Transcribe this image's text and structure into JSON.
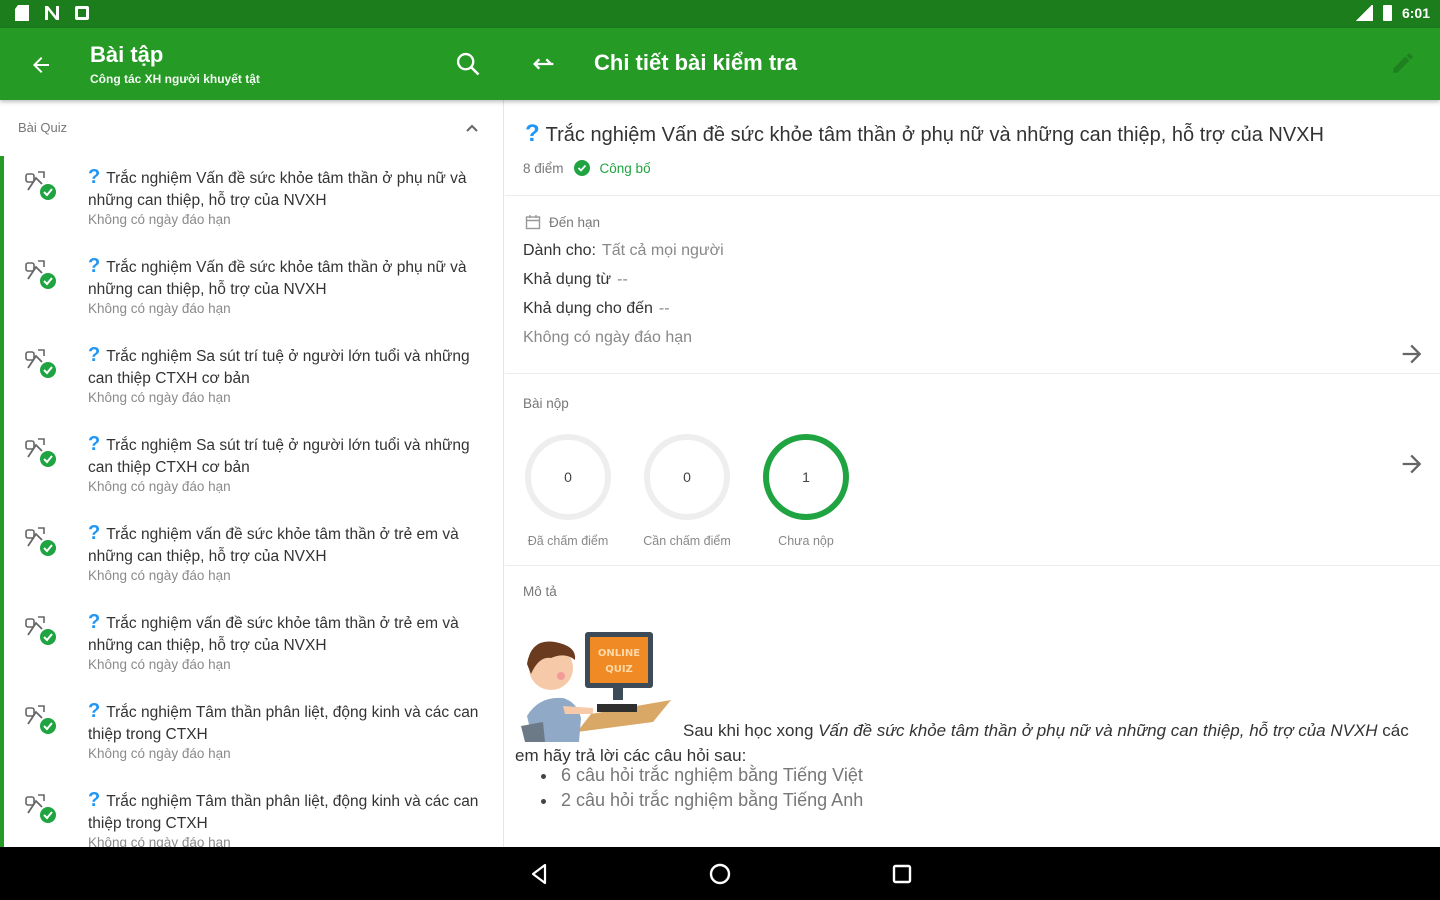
{
  "status_bar": {
    "time": "6:01",
    "left_icons": [
      "sd-card-icon",
      "n-icon",
      "photo-icon"
    ],
    "right_icons": [
      "signal-icon",
      "battery-icon"
    ]
  },
  "app_bar": {
    "title": "Bài tập",
    "subtitle": "Công tác XH người khuyết tật",
    "detail_title": "Chi tiết bài kiểm tra",
    "color": "#259a25"
  },
  "left_panel": {
    "section_label": "Bài Quiz",
    "items": [
      {
        "title": "Trắc nghiệm Vấn đề sức khỏe tâm thần ở phụ nữ và những can thiệp, hỗ trợ của NVXH",
        "due": "Không có ngày đáo hạn"
      },
      {
        "title": "Trắc nghiệm Vấn đề sức khỏe tâm thần ở phụ nữ và những can thiệp, hỗ trợ của NVXH",
        "due": "Không có ngày đáo hạn"
      },
      {
        "title": "Trắc nghiệm Sa sút trí tuệ ở người lớn tuổi và những can thiệp CTXH cơ bản",
        "due": "Không có ngày đáo hạn"
      },
      {
        "title": "Trắc nghiệm Sa sút trí tuệ ở người lớn tuổi và những can thiệp CTXH cơ bản",
        "due": "Không có ngày đáo hạn"
      },
      {
        "title": "Trắc nghiệm vấn đề sức khỏe tâm thần ở trẻ em và những can thiệp, hỗ trợ của NVXH",
        "due": "Không có ngày đáo hạn"
      },
      {
        "title": "Trắc nghiệm vấn đề sức khỏe tâm thần ở trẻ em và những can thiệp, hỗ trợ của NVXH",
        "due": "Không có ngày đáo hạn"
      },
      {
        "title": "Trắc nghiệm Tâm thần phân liệt, động kinh và các can thiệp trong CTXH",
        "due": "Không có ngày đáo hạn"
      },
      {
        "title": "Trắc nghiệm Tâm thần phân liệt, động kinh và các can thiệp trong CTXH",
        "due": "Không có ngày đáo hạn"
      }
    ]
  },
  "detail": {
    "question_mark": "?",
    "title": "Trắc nghiệm Vấn đề sức khỏe tâm thần ở phụ nữ và những can thiệp, hỗ trợ của NVXH",
    "points": "8 điểm",
    "published": "Công bố",
    "due": {
      "header": "Đến hạn",
      "for_label": "Dành cho:",
      "for_value": "Tất cả mọi người",
      "available_from_label": "Khả dụng từ",
      "available_from_value": "--",
      "available_until_label": "Khả dụng cho đến",
      "available_until_value": "--",
      "no_due": "Không có ngày đáo hạn"
    },
    "submissions": {
      "label": "Bài nộp",
      "graded": {
        "count": "0",
        "label": "Đã chấm điểm"
      },
      "needs_grading": {
        "count": "0",
        "label": "Cần chấm điểm"
      },
      "not_submitted": {
        "count": "1",
        "label": "Chưa nộp"
      }
    },
    "description": {
      "label": "Mô tả",
      "illustration_text": "ONLINE QUIZ",
      "intro_before": "Sau khi học xong ",
      "intro_italic": "Vấn đề sức khỏe tâm thần ở phụ nữ và những can thiệp, hỗ trợ của NVXH",
      "intro_after": " các em hãy trả lời các câu hỏi sau:",
      "bullets": [
        "6 câu hỏi trắc nghiệm bằng Tiếng Việt",
        "2 câu hỏi trắc nghiệm bằng Tiếng Anh"
      ]
    }
  },
  "colors": {
    "status_bar": "#1b7d1b",
    "primary": "#259a25",
    "published": "#1fa441",
    "question": "#2196f3"
  }
}
